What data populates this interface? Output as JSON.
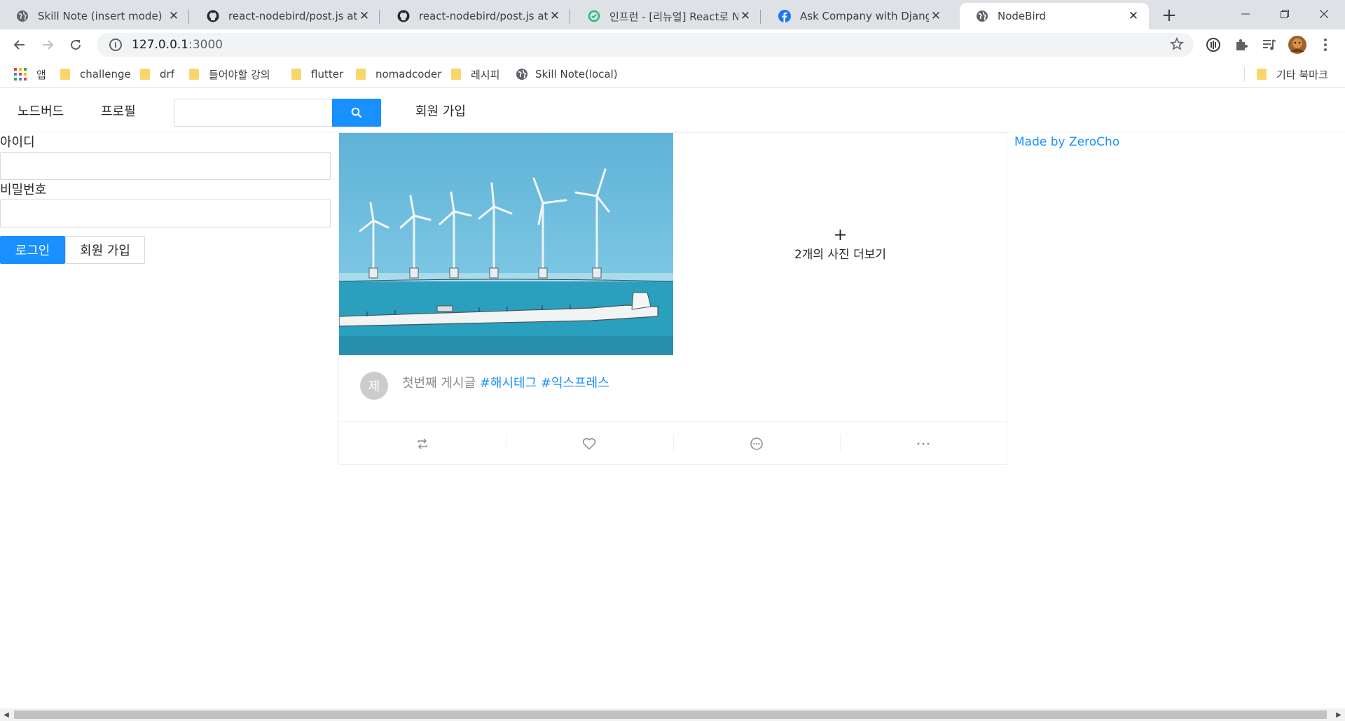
{
  "browser": {
    "tabs": [
      {
        "title": "Skill Note (insert mode)",
        "icon": "globe-icon"
      },
      {
        "title": "react-nodebird/post.js at re",
        "icon": "github-icon"
      },
      {
        "title": "react-nodebird/post.js at re",
        "icon": "github-icon"
      },
      {
        "title": "인프런 - [리뉴얼] React로 N",
        "icon": "inflearn-icon"
      },
      {
        "title": "Ask Company with Django/",
        "icon": "facebook-icon"
      },
      {
        "title": "NodeBird",
        "icon": "globe-icon",
        "active": true
      }
    ],
    "url_host": "127.0.0.1",
    "url_port": ":3000",
    "bookmarks": [
      {
        "label": "앱",
        "icon": "apps-grid-icon"
      },
      {
        "label": "challenge",
        "icon": "folder-icon"
      },
      {
        "label": "drf",
        "icon": "folder-icon"
      },
      {
        "label": "들어야할 강의",
        "icon": "folder-icon"
      },
      {
        "label": "flutter",
        "icon": "folder-icon"
      },
      {
        "label": "nomadcoder",
        "icon": "folder-icon"
      },
      {
        "label": "레시피",
        "icon": "folder-icon"
      },
      {
        "label": "Skill Note(local)",
        "icon": "globe-icon"
      }
    ],
    "other_bookmarks": "기타 북마크"
  },
  "nav": {
    "home": "노드버드",
    "profile": "프로필",
    "signup": "회원 가입",
    "search_value": ""
  },
  "login": {
    "id_label": "아이디",
    "id_value": "",
    "password_label": "비밀번호",
    "password_value": "",
    "login_button": "로그인",
    "signup_button": "회원 가입"
  },
  "post": {
    "more_photos": "2개의 사진 더보기",
    "avatar_initial": "제",
    "text": "첫번째 게시글",
    "hashtags": [
      "#해시테그",
      "#익스프레스"
    ]
  },
  "credit": "Made by ZeroCho",
  "colors": {
    "primary": "#1890ff",
    "border": "#d9d9d9",
    "tabstrip": "#dee1e6"
  }
}
